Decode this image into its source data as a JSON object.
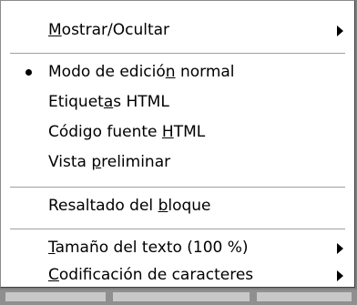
{
  "menu": {
    "items": [
      {
        "pre": "",
        "acc": "M",
        "post": "ostrar/Ocultar",
        "submenu": true
      },
      {
        "pre": "Modo de edició",
        "acc": "n",
        "post": " normal",
        "checked": true
      },
      {
        "pre": "Etiquet",
        "acc": "a",
        "post": "s HTML"
      },
      {
        "pre": "Código fuente ",
        "acc": "H",
        "post": "TML"
      },
      {
        "pre": "Vista ",
        "acc": "p",
        "post": "reliminar"
      },
      {
        "pre": "Resaltado del ",
        "acc": "b",
        "post": "loque"
      },
      {
        "pre": "",
        "acc": "T",
        "post": "amaño del texto (100 %)",
        "submenu": true
      },
      {
        "pre": "",
        "acc": "C",
        "post": "odificación de caracteres",
        "submenu": true
      }
    ]
  }
}
